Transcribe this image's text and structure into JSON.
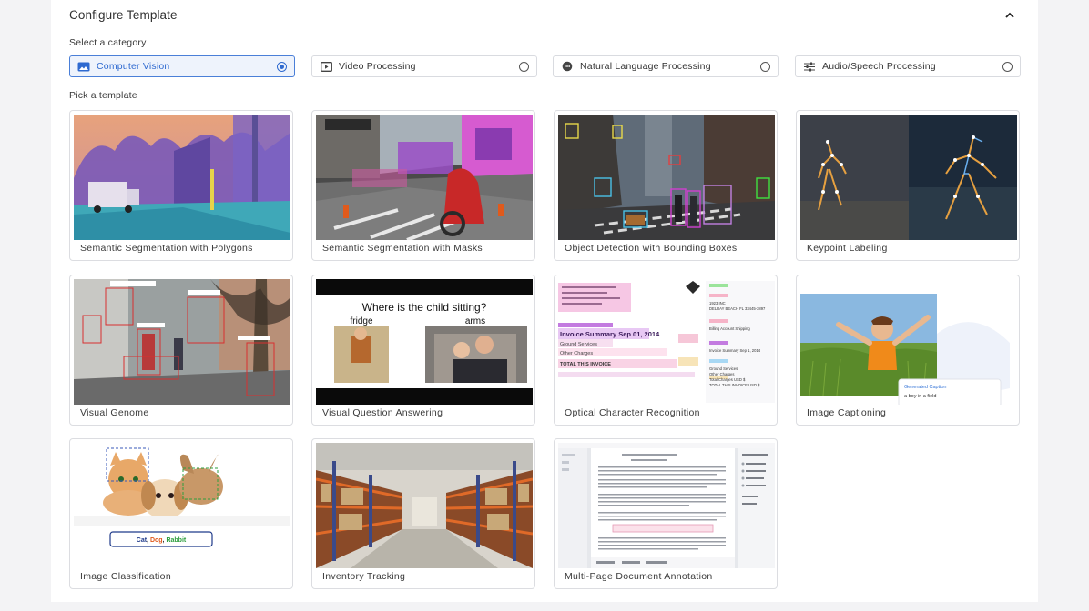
{
  "header": {
    "title": "Configure Template"
  },
  "labels": {
    "select_category": "Select a category",
    "pick_template": "Pick a template"
  },
  "categories": [
    {
      "label": "Computer Vision",
      "icon": "image-icon",
      "selected": true
    },
    {
      "label": "Video Processing",
      "icon": "video-icon",
      "selected": false
    },
    {
      "label": "Natural Language Processing",
      "icon": "chat-icon",
      "selected": false
    },
    {
      "label": "Audio/Speech Processing",
      "icon": "sliders-icon",
      "selected": false
    }
  ],
  "templates": [
    {
      "label": "Semantic Segmentation with Polygons"
    },
    {
      "label": "Semantic Segmentation with Masks"
    },
    {
      "label": "Object Detection with Bounding Boxes"
    },
    {
      "label": "Keypoint Labeling"
    },
    {
      "label": "Visual Genome"
    },
    {
      "label": "Visual Question Answering"
    },
    {
      "label": "Optical Character Recognition"
    },
    {
      "label": "Image Captioning"
    },
    {
      "label": "Image Classification"
    },
    {
      "label": "Inventory Tracking"
    },
    {
      "label": "Multi-Page Document Annotation"
    }
  ],
  "thumbnails": {
    "vqa": {
      "question": "Where is the child sitting?",
      "answer_left": "fridge",
      "answer_right": "arms"
    },
    "ocr": {
      "left_lines": [
        "Invoice Summary Sep 01, 2014",
        "Ground Services",
        "Other Charges",
        "TOTAL THIS INVOICE"
      ],
      "right_lines": [
        "1923 INC",
        "DELRAY BEACH FL 33445-3897",
        "Billing Account Shipping",
        "Invoice Summary Sep 1, 2014",
        "Ground Services",
        "Other Charges",
        "Total Charges USD $",
        "TOTAL THIS INVOICE USD $"
      ]
    },
    "captioning": {
      "caption_title": "Generated Caption",
      "caption_text": "a boy in a field"
    },
    "classification": {
      "words": [
        "Cat",
        "Dog",
        "Rabbit"
      ],
      "colors": [
        "#1f3a8a",
        "#e05a1c",
        "#2e9e3e"
      ]
    }
  },
  "colors": {
    "accent": "#2f6ad0",
    "selected_bg": "#eef3fc",
    "border": "#dcdde1"
  }
}
